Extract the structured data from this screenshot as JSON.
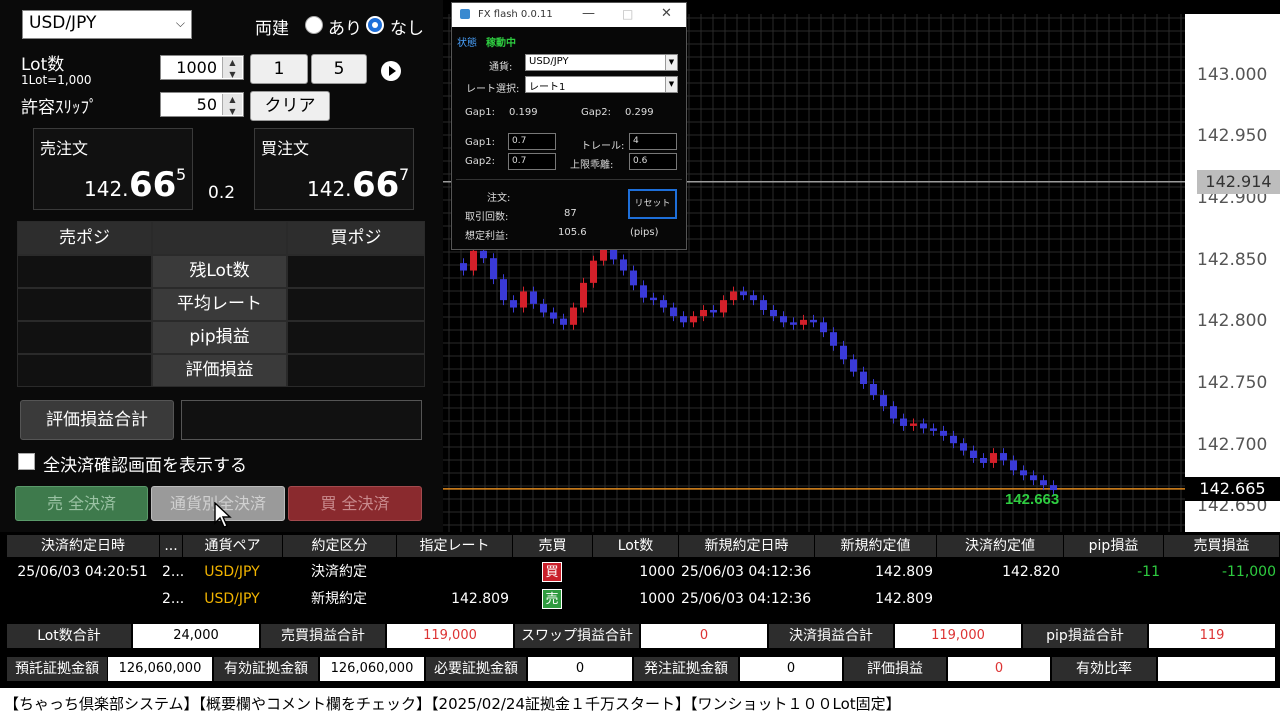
{
  "left": {
    "currency_pair": "USD/JPY",
    "ryodate_label": "両建",
    "ari_label": "あり",
    "nashi_label": "なし",
    "lot_label": "Lot数",
    "lot_unit_label": "1Lot=1,000",
    "lot_value": "1000",
    "lot_btn_1": "1",
    "lot_btn_5": "5",
    "slip_label": "許容ｽﾘｯﾌﾟ",
    "slip_value": "50",
    "clear_label": "クリア",
    "sell_order_label": "売注文",
    "sell_price_prefix": "142.",
    "sell_price_main": "66",
    "sell_price_sup": "5",
    "spread": "0.2",
    "buy_order_label": "買注文",
    "buy_price_prefix": "142.",
    "buy_price_main": "66",
    "buy_price_sup": "7",
    "sell_pos_header": "売ポジ",
    "buy_pos_header": "買ポジ",
    "rows": [
      "残Lot数",
      "平均レート",
      "pip損益",
      "評価損益"
    ],
    "eval_total_label": "評価損益合計",
    "confirm_label": "全決済確認画面を表示する",
    "sell_all_label": "売 全決済",
    "per_currency_label": "通貨別全決済",
    "buy_all_label": "買 全決済"
  },
  "chart_data": {
    "type": "candlestick",
    "ylim": [
      142.63,
      143.05
    ],
    "y_ticks": [
      "143.000",
      "142.950",
      "142.900",
      "142.850",
      "142.800",
      "142.750",
      "142.700",
      "142.650"
    ],
    "current_price_marker": "142.914",
    "last_price_marker": "142.665",
    "last_price_label": "142.663",
    "colors": {
      "up": "#d4202a",
      "down": "#3a3ad8",
      "grid": "#2a2a2a",
      "last_line": "#e08a1e",
      "label": "#2ecc40"
    },
    "closes": [
      142.842,
      142.858,
      142.852,
      142.835,
      142.818,
      142.812,
      142.825,
      142.815,
      142.808,
      142.803,
      142.798,
      142.812,
      142.832,
      142.85,
      142.86,
      142.851,
      142.842,
      142.83,
      142.82,
      142.818,
      142.812,
      142.805,
      142.8,
      142.805,
      142.81,
      142.808,
      142.818,
      142.825,
      142.822,
      142.818,
      142.81,
      142.805,
      142.8,
      142.798,
      142.802,
      142.8,
      142.792,
      142.781,
      142.77,
      142.76,
      142.75,
      142.741,
      142.732,
      142.722,
      142.716,
      142.718,
      142.714,
      142.712,
      142.708,
      142.702,
      142.696,
      142.69,
      142.686,
      142.694,
      142.688,
      142.68,
      142.676,
      142.672,
      142.668,
      142.664
    ]
  },
  "popup": {
    "title": "FX flash 0.0.11",
    "status_label": "状態",
    "status_value": "稼動中",
    "currency_label": "通貨:",
    "currency_value": "USD/JPY",
    "rate_label": "レート選択:",
    "rate_value": "レート1",
    "gap1_label": "Gap1:",
    "gap1_value": "0.199",
    "gap2_label": "Gap2:",
    "gap2_value": "0.299",
    "gap1_in_label": "Gap1:",
    "gap1_in": "0.7",
    "gap2_in_label": "Gap2:",
    "gap2_in": "0.7",
    "trail_label": "トレール:",
    "trail_value": "4",
    "limit_label": "上限乖離:",
    "limit_value": "0.6",
    "order_label": "注文:",
    "trades_label": "取引回数:",
    "trades_value": "87",
    "profit_label": "想定利益:",
    "profit_value": "105.6",
    "pips_label": "(pips)",
    "reset_label": "リセット"
  },
  "trades": {
    "headers": [
      "決済約定日時",
      "...",
      "通貨ペア",
      "約定区分",
      "指定レート",
      "売買",
      "Lot数",
      "新規約定日時",
      "新規約定値",
      "決済約定値",
      "pip損益",
      "売買損益"
    ],
    "rows": [
      [
        "25/06/03 04:20:51",
        "2...",
        "USD/JPY",
        "決済約定",
        "",
        "買",
        "1000",
        "25/06/03 04:12:36",
        "142.809",
        "142.820",
        "-11",
        "-11,000"
      ],
      [
        "",
        "2...",
        "USD/JPY",
        "新規約定",
        "142.809",
        "売",
        "1000",
        "25/06/03 04:12:36",
        "142.809",
        "",
        "",
        ""
      ]
    ]
  },
  "summary1": {
    "lot_total_label": "Lot数合計",
    "lot_total": "24,000",
    "trade_pl_label": "売買損益合計",
    "trade_pl": "119,000",
    "swap_label": "スワップ損益合計",
    "swap": "0",
    "settle_label": "決済損益合計",
    "settle": "119,000",
    "pip_label": "pip損益合計",
    "pip": "119"
  },
  "summary2": {
    "deposit_label": "預託証拠金額",
    "deposit": "126,060,000",
    "valid_label": "有効証拠金額",
    "valid": "126,060,000",
    "required_label": "必要証拠金額",
    "required": "0",
    "order_margin_label": "発注証拠金額",
    "order_margin": "0",
    "eval_label": "評価損益",
    "eval": "0",
    "ratio_label": "有効比率",
    "ratio": ""
  },
  "footer": "【ちゃっち倶楽部システム】【概要欄やコメント欄をチェック】【2025/02/24証拠金１千万スタート】【ワンショット１００Lot固定】"
}
